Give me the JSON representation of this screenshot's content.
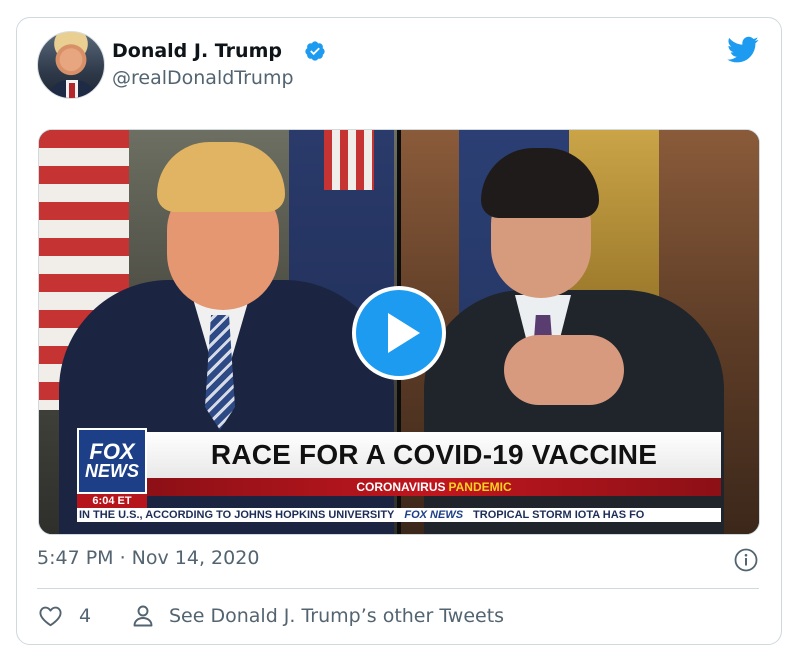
{
  "author": {
    "name": "Donald J. Trump",
    "handle": "@realDonaldTrump",
    "verified": true,
    "avatar_icon": "profile-photo"
  },
  "media": {
    "type": "video",
    "play_icon": "play-icon",
    "lower_third": {
      "network_logo_line1": "FOX",
      "network_logo_line2": "NEWS",
      "time": "6:04 ET",
      "headline": "RACE FOR A COVID-19 VACCINE",
      "subhead_prefix": "CORONAVIRUS",
      "subhead_highlight": "PANDEMIC",
      "ticker_left": "IN THE U.S., ACCORDING TO JOHNS HOPKINS UNIVERSITY",
      "ticker_brand": "FOX NEWS",
      "ticker_right": "TROPICAL STORM IOTA HAS FO"
    }
  },
  "timestamp": "5:47 PM · Nov 14, 2020",
  "actions": {
    "like_count": "4",
    "other_tweets_label": "See Donald J. Trump’s other Tweets"
  },
  "colors": {
    "accent": "#1d9bf0",
    "secondary_text": "#536471",
    "border": "#cfd9de"
  }
}
